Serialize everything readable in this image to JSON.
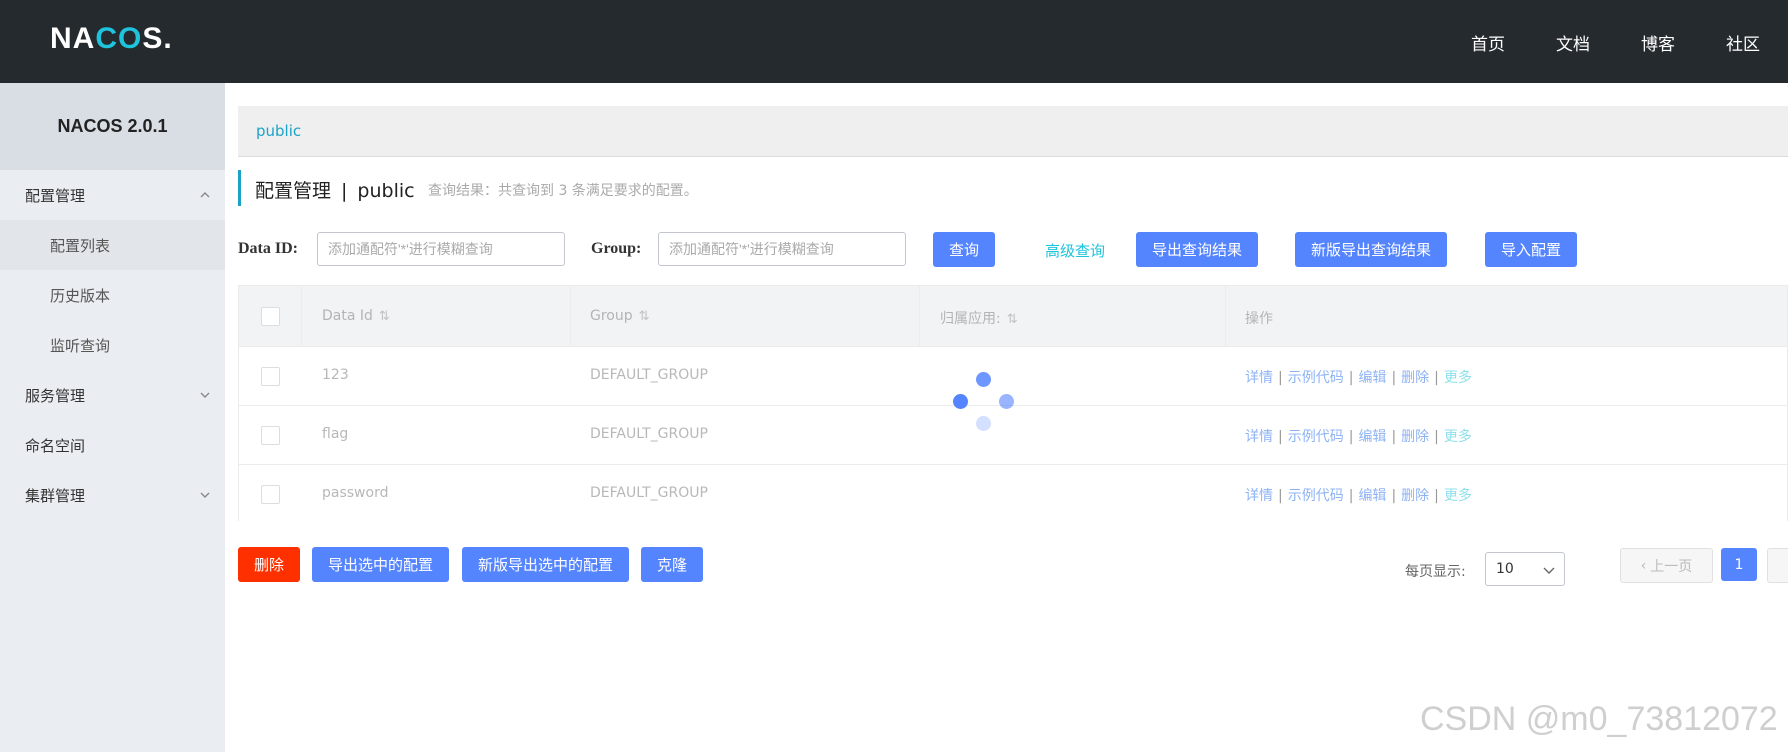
{
  "header": {
    "logo_text_left": "NA",
    "logo_text_accent": "CO",
    "logo_text_right": "S.",
    "nav": [
      "首页",
      "文档",
      "博客",
      "社区"
    ]
  },
  "sidebar": {
    "title": "NACOS 2.0.1",
    "items": [
      {
        "label": "配置管理",
        "arrow": "up"
      },
      {
        "label": "配置列表"
      },
      {
        "label": "历史版本"
      },
      {
        "label": "监听查询"
      },
      {
        "label": "服务管理",
        "arrow": "down"
      },
      {
        "label": "命名空间"
      },
      {
        "label": "集群管理",
        "arrow": "down"
      }
    ]
  },
  "breadcrumb": {
    "namespace": "public"
  },
  "page": {
    "title": "配置管理",
    "separator": "|",
    "namespace": "public",
    "result_text": "查询结果：共查询到 3 条满足要求的配置。"
  },
  "filters": {
    "data_id_label": "Data ID:",
    "data_id_placeholder": "添加通配符'*'进行模糊查询",
    "group_label": "Group:",
    "group_placeholder": "添加通配符'*'进行模糊查询",
    "query_button": "查询",
    "advanced_link": "高级查询",
    "export_button": "导出查询结果",
    "new_export_button": "新版导出查询结果",
    "import_button": "导入配置"
  },
  "table": {
    "headers": {
      "data_id": "Data Id",
      "group": "Group",
      "app": "归属应用:",
      "ops": "操作"
    },
    "rows": [
      {
        "data_id": "123",
        "group": "DEFAULT_GROUP",
        "app": ""
      },
      {
        "data_id": "flag",
        "group": "DEFAULT_GROUP",
        "app": ""
      },
      {
        "data_id": "password",
        "group": "DEFAULT_GROUP",
        "app": ""
      }
    ],
    "ops": {
      "detail": "详情",
      "sample": "示例代码",
      "edit": "编辑",
      "delete": "删除",
      "more": "更多",
      "sep": "|"
    }
  },
  "bulk_actions": {
    "delete": "删除",
    "export_selected": "导出选中的配置",
    "new_export_selected": "新版导出选中的配置",
    "clone": "克隆"
  },
  "pagination": {
    "page_size_label": "每页显示:",
    "page_size": "10",
    "prev": "上一页",
    "current": "1"
  },
  "watermark": "CSDN @m0_73812072",
  "colors": {
    "primary": "#5584ff",
    "danger": "#ff3000",
    "accent": "#1ec3dc",
    "header_bg": "#252a2f",
    "sidebar_bg": "#eaedf1"
  }
}
